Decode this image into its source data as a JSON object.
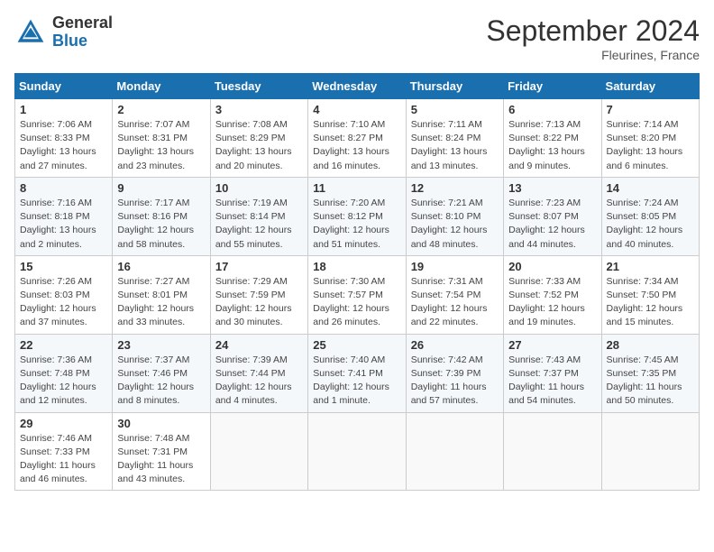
{
  "logo": {
    "line1": "General",
    "line2": "Blue"
  },
  "title": "September 2024",
  "location": "Fleurines, France",
  "days_header": [
    "Sunday",
    "Monday",
    "Tuesday",
    "Wednesday",
    "Thursday",
    "Friday",
    "Saturday"
  ],
  "weeks": [
    [
      {
        "day": "1",
        "sunrise": "Sunrise: 7:06 AM",
        "sunset": "Sunset: 8:33 PM",
        "daylight": "Daylight: 13 hours and 27 minutes."
      },
      {
        "day": "2",
        "sunrise": "Sunrise: 7:07 AM",
        "sunset": "Sunset: 8:31 PM",
        "daylight": "Daylight: 13 hours and 23 minutes."
      },
      {
        "day": "3",
        "sunrise": "Sunrise: 7:08 AM",
        "sunset": "Sunset: 8:29 PM",
        "daylight": "Daylight: 13 hours and 20 minutes."
      },
      {
        "day": "4",
        "sunrise": "Sunrise: 7:10 AM",
        "sunset": "Sunset: 8:27 PM",
        "daylight": "Daylight: 13 hours and 16 minutes."
      },
      {
        "day": "5",
        "sunrise": "Sunrise: 7:11 AM",
        "sunset": "Sunset: 8:24 PM",
        "daylight": "Daylight: 13 hours and 13 minutes."
      },
      {
        "day": "6",
        "sunrise": "Sunrise: 7:13 AM",
        "sunset": "Sunset: 8:22 PM",
        "daylight": "Daylight: 13 hours and 9 minutes."
      },
      {
        "day": "7",
        "sunrise": "Sunrise: 7:14 AM",
        "sunset": "Sunset: 8:20 PM",
        "daylight": "Daylight: 13 hours and 6 minutes."
      }
    ],
    [
      {
        "day": "8",
        "sunrise": "Sunrise: 7:16 AM",
        "sunset": "Sunset: 8:18 PM",
        "daylight": "Daylight: 13 hours and 2 minutes."
      },
      {
        "day": "9",
        "sunrise": "Sunrise: 7:17 AM",
        "sunset": "Sunset: 8:16 PM",
        "daylight": "Daylight: 12 hours and 58 minutes."
      },
      {
        "day": "10",
        "sunrise": "Sunrise: 7:19 AM",
        "sunset": "Sunset: 8:14 PM",
        "daylight": "Daylight: 12 hours and 55 minutes."
      },
      {
        "day": "11",
        "sunrise": "Sunrise: 7:20 AM",
        "sunset": "Sunset: 8:12 PM",
        "daylight": "Daylight: 12 hours and 51 minutes."
      },
      {
        "day": "12",
        "sunrise": "Sunrise: 7:21 AM",
        "sunset": "Sunset: 8:10 PM",
        "daylight": "Daylight: 12 hours and 48 minutes."
      },
      {
        "day": "13",
        "sunrise": "Sunrise: 7:23 AM",
        "sunset": "Sunset: 8:07 PM",
        "daylight": "Daylight: 12 hours and 44 minutes."
      },
      {
        "day": "14",
        "sunrise": "Sunrise: 7:24 AM",
        "sunset": "Sunset: 8:05 PM",
        "daylight": "Daylight: 12 hours and 40 minutes."
      }
    ],
    [
      {
        "day": "15",
        "sunrise": "Sunrise: 7:26 AM",
        "sunset": "Sunset: 8:03 PM",
        "daylight": "Daylight: 12 hours and 37 minutes."
      },
      {
        "day": "16",
        "sunrise": "Sunrise: 7:27 AM",
        "sunset": "Sunset: 8:01 PM",
        "daylight": "Daylight: 12 hours and 33 minutes."
      },
      {
        "day": "17",
        "sunrise": "Sunrise: 7:29 AM",
        "sunset": "Sunset: 7:59 PM",
        "daylight": "Daylight: 12 hours and 30 minutes."
      },
      {
        "day": "18",
        "sunrise": "Sunrise: 7:30 AM",
        "sunset": "Sunset: 7:57 PM",
        "daylight": "Daylight: 12 hours and 26 minutes."
      },
      {
        "day": "19",
        "sunrise": "Sunrise: 7:31 AM",
        "sunset": "Sunset: 7:54 PM",
        "daylight": "Daylight: 12 hours and 22 minutes."
      },
      {
        "day": "20",
        "sunrise": "Sunrise: 7:33 AM",
        "sunset": "Sunset: 7:52 PM",
        "daylight": "Daylight: 12 hours and 19 minutes."
      },
      {
        "day": "21",
        "sunrise": "Sunrise: 7:34 AM",
        "sunset": "Sunset: 7:50 PM",
        "daylight": "Daylight: 12 hours and 15 minutes."
      }
    ],
    [
      {
        "day": "22",
        "sunrise": "Sunrise: 7:36 AM",
        "sunset": "Sunset: 7:48 PM",
        "daylight": "Daylight: 12 hours and 12 minutes."
      },
      {
        "day": "23",
        "sunrise": "Sunrise: 7:37 AM",
        "sunset": "Sunset: 7:46 PM",
        "daylight": "Daylight: 12 hours and 8 minutes."
      },
      {
        "day": "24",
        "sunrise": "Sunrise: 7:39 AM",
        "sunset": "Sunset: 7:44 PM",
        "daylight": "Daylight: 12 hours and 4 minutes."
      },
      {
        "day": "25",
        "sunrise": "Sunrise: 7:40 AM",
        "sunset": "Sunset: 7:41 PM",
        "daylight": "Daylight: 12 hours and 1 minute."
      },
      {
        "day": "26",
        "sunrise": "Sunrise: 7:42 AM",
        "sunset": "Sunset: 7:39 PM",
        "daylight": "Daylight: 11 hours and 57 minutes."
      },
      {
        "day": "27",
        "sunrise": "Sunrise: 7:43 AM",
        "sunset": "Sunset: 7:37 PM",
        "daylight": "Daylight: 11 hours and 54 minutes."
      },
      {
        "day": "28",
        "sunrise": "Sunrise: 7:45 AM",
        "sunset": "Sunset: 7:35 PM",
        "daylight": "Daylight: 11 hours and 50 minutes."
      }
    ],
    [
      {
        "day": "29",
        "sunrise": "Sunrise: 7:46 AM",
        "sunset": "Sunset: 7:33 PM",
        "daylight": "Daylight: 11 hours and 46 minutes."
      },
      {
        "day": "30",
        "sunrise": "Sunrise: 7:48 AM",
        "sunset": "Sunset: 7:31 PM",
        "daylight": "Daylight: 11 hours and 43 minutes."
      },
      null,
      null,
      null,
      null,
      null
    ]
  ]
}
